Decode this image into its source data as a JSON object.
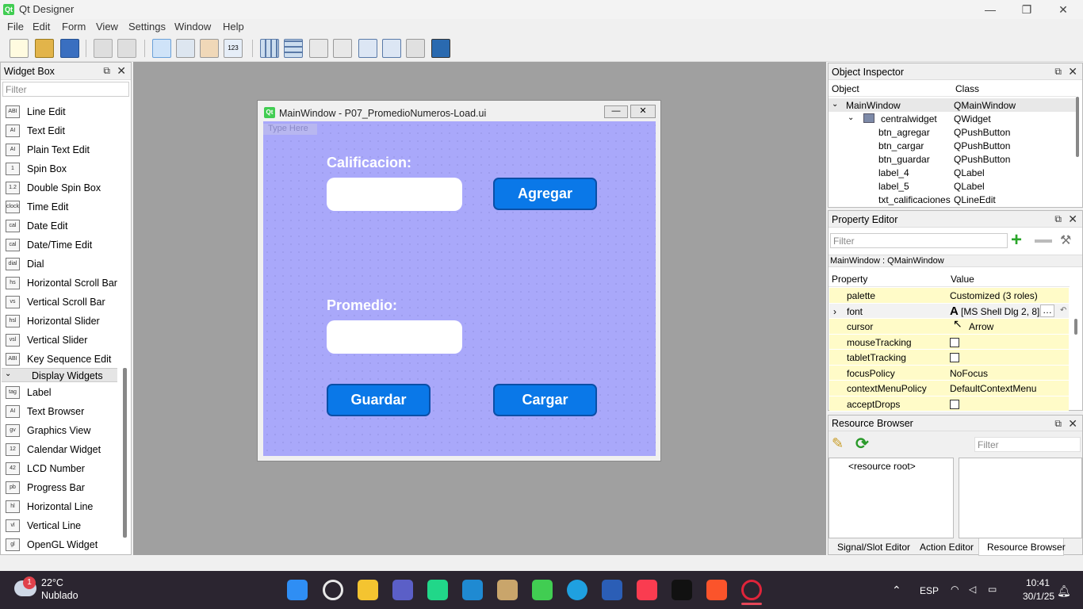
{
  "window": {
    "title": "Qt Designer",
    "logo": "Qt"
  },
  "menu": [
    "File",
    "Edit",
    "Form",
    "View",
    "Settings",
    "Window",
    "Help"
  ],
  "widget_box": {
    "title": "Widget Box",
    "filter_placeholder": "Filter",
    "items": [
      {
        "label": "Line Edit",
        "icon": "ABI"
      },
      {
        "label": "Text Edit",
        "icon": "AI"
      },
      {
        "label": "Plain Text Edit",
        "icon": "AI"
      },
      {
        "label": "Spin Box",
        "icon": "1"
      },
      {
        "label": "Double Spin Box",
        "icon": "1.2"
      },
      {
        "label": "Time Edit",
        "icon": "clock"
      },
      {
        "label": "Date Edit",
        "icon": "cal"
      },
      {
        "label": "Date/Time Edit",
        "icon": "cal"
      },
      {
        "label": "Dial",
        "icon": "dial"
      },
      {
        "label": "Horizontal Scroll Bar",
        "icon": "hs"
      },
      {
        "label": "Vertical Scroll Bar",
        "icon": "vs"
      },
      {
        "label": "Horizontal Slider",
        "icon": "hsl"
      },
      {
        "label": "Vertical Slider",
        "icon": "vsl"
      },
      {
        "label": "Key Sequence Edit",
        "icon": "ABI"
      }
    ],
    "category": "Display Widgets",
    "display_items": [
      {
        "label": "Label",
        "icon": "tag"
      },
      {
        "label": "Text Browser",
        "icon": "AI"
      },
      {
        "label": "Graphics View",
        "icon": "gv"
      },
      {
        "label": "Calendar Widget",
        "icon": "12"
      },
      {
        "label": "LCD Number",
        "icon": "42"
      },
      {
        "label": "Progress Bar",
        "icon": "pb"
      },
      {
        "label": "Horizontal Line",
        "icon": "hl"
      },
      {
        "label": "Vertical Line",
        "icon": "vl"
      },
      {
        "label": "OpenGL Widget",
        "icon": "gl"
      }
    ]
  },
  "form": {
    "title": "MainWindow - P07_PromedioNumeros-Load.ui",
    "menu_placeholder": "Type Here",
    "label_calificacion": "Calificacion:",
    "label_promedio": "Promedio:",
    "btn_agregar": "Agregar",
    "btn_guardar": "Guardar",
    "btn_cargar": "Cargar"
  },
  "object_inspector": {
    "title": "Object Inspector",
    "col_object": "Object",
    "col_class": "Class",
    "rows": [
      {
        "object": "MainWindow",
        "class": "QMainWindow"
      },
      {
        "object": "centralwidget",
        "class": "QWidget"
      },
      {
        "object": "btn_agregar",
        "class": "QPushButton"
      },
      {
        "object": "btn_cargar",
        "class": "QPushButton"
      },
      {
        "object": "btn_guardar",
        "class": "QPushButton"
      },
      {
        "object": "label_4",
        "class": "QLabel"
      },
      {
        "object": "label_5",
        "class": "QLabel"
      },
      {
        "object": "txt_calificaciones",
        "class": "QLineEdit"
      }
    ]
  },
  "property_editor": {
    "title": "Property Editor",
    "filter_placeholder": "Filter",
    "context": "MainWindow : QMainWindow",
    "col_property": "Property",
    "col_value": "Value",
    "rows": [
      {
        "name": "palette",
        "value": "Customized (3 roles)"
      },
      {
        "name": "font",
        "value": "[MS Shell Dlg 2, 8]"
      },
      {
        "name": "cursor",
        "value": "Arrow"
      },
      {
        "name": "mouseTracking",
        "value": ""
      },
      {
        "name": "tabletTracking",
        "value": ""
      },
      {
        "name": "focusPolicy",
        "value": "NoFocus"
      },
      {
        "name": "contextMenuPolicy",
        "value": "DefaultContextMenu"
      },
      {
        "name": "acceptDrops",
        "value": ""
      }
    ]
  },
  "resource_browser": {
    "title": "Resource Browser",
    "filter_placeholder": "Filter",
    "root": "<resource root>"
  },
  "bottom_tabs": [
    "Signal/Slot Editor",
    "Action Editor",
    "Resource Browser"
  ],
  "taskbar": {
    "weather_temp": "22°C",
    "weather_desc": "Nublado",
    "badge": "1",
    "lang": "ESP",
    "time": "10:41",
    "date": "30/1/25"
  }
}
